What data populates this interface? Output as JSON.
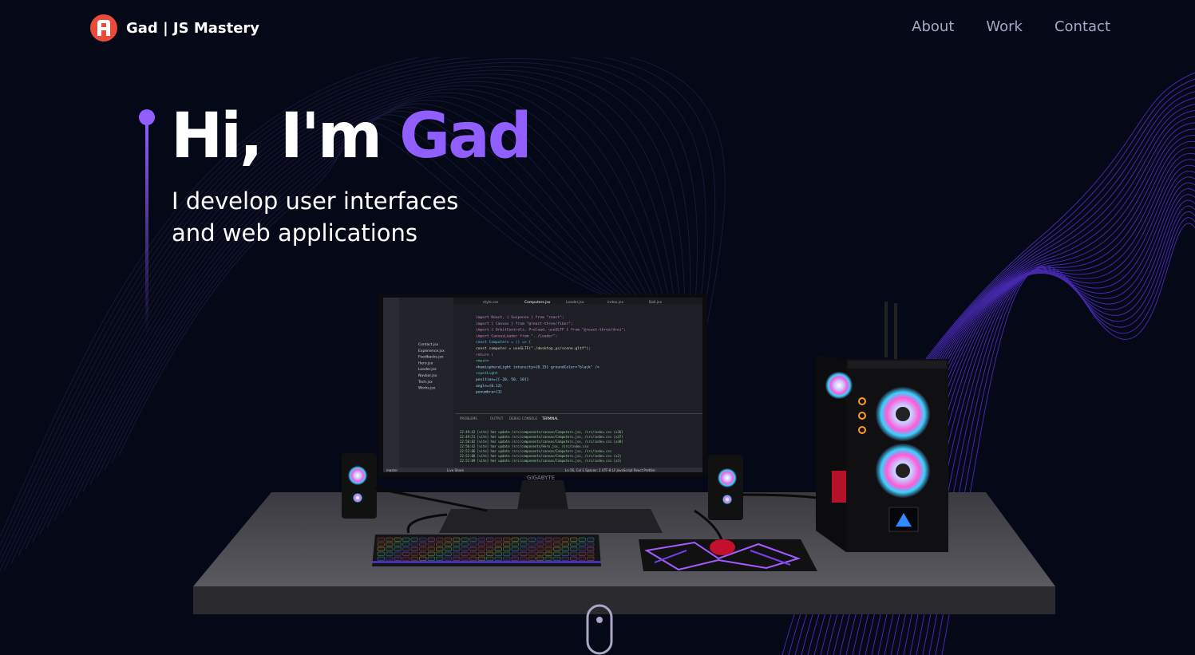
{
  "header": {
    "brand_name": "Gad",
    "brand_suffix": " | JS Mastery",
    "logo_icon": "logo-icon",
    "nav": [
      {
        "label": "About"
      },
      {
        "label": "Work"
      },
      {
        "label": "Contact"
      }
    ]
  },
  "hero": {
    "greeting": "Hi, I'm ",
    "name": "Gad",
    "subtitle_line1": "I develop user interfaces",
    "subtitle_line2": "and web applications"
  },
  "scene": {
    "monitor_brand": "GIGABYTE",
    "editor": {
      "tabs": [
        "style.css",
        "Computers.jsx",
        "Loader.jsx",
        "index.jsx",
        "Ball.jsx"
      ],
      "files": [
        "Contact.jsx",
        "Experience.jsx",
        "Feedbacks.jsx",
        "Hero.jsx",
        "Loader.jsx",
        "Navbar.jsx",
        "Tech.jsx",
        "Works.jsx"
      ],
      "code": [
        "import React, { Suspense } from \"react\";",
        "import { Canvas } from \"@react-three/fiber\";",
        "import { OrbitControls, Preload, useGLTF } from \"@react-three/drei\";",
        "import CanvasLoader from \"../Loader\";",
        "const Computers = () => {",
        "  const computer = useGLTF(\"./desktop_pc/scene.gltf\");",
        "  return (",
        "    <mesh>",
        "      <hemisphereLight intensity={0.15} groundColor=\"black\" />",
        "      <spotLight",
        "        position={[-20, 50, 10]}",
        "        angle={0.12}",
        "        penumbra={1}"
      ],
      "terminal_tabs": [
        "PROBLEMS",
        "OUTPUT",
        "DEBUG CONSOLE",
        "TERMINAL"
      ],
      "terminal_lines": [
        "22:49:42 [vite] hmr update /src/components/canvas/Computers.jsx, /src/index.css (x36)",
        "22:49:51 [vite] hmr update /src/components/canvas/Computers.jsx, /src/index.css (x37)",
        "22:50:02 [vite] hmr update /src/components/canvas/Computers.jsx, /src/index.css (x38)",
        "22:50:42 [vite] hmr update /src/components/Hero.jsx, /src/index.css",
        "22:52:06 [vite] hmr update /src/components/canvas/Computers.jsx, /src/index.css",
        "22:52:08 [vite] hmr update /src/components/canvas/Computers.jsx, /src/index.css (x2)",
        "22:52:09 [vite] hmr update /src/components/canvas/Computers.jsx, /src/index.css (x3)"
      ],
      "status_left": "master",
      "status_live": "Live Share",
      "status_right": "Ln 56, Col 1   Spaces: 2   UTF-8   LF   JavaScript React   Prettier"
    }
  },
  "colors": {
    "background": "#050816",
    "accent": "#915eff",
    "nav_text": "#aaa6c3"
  }
}
